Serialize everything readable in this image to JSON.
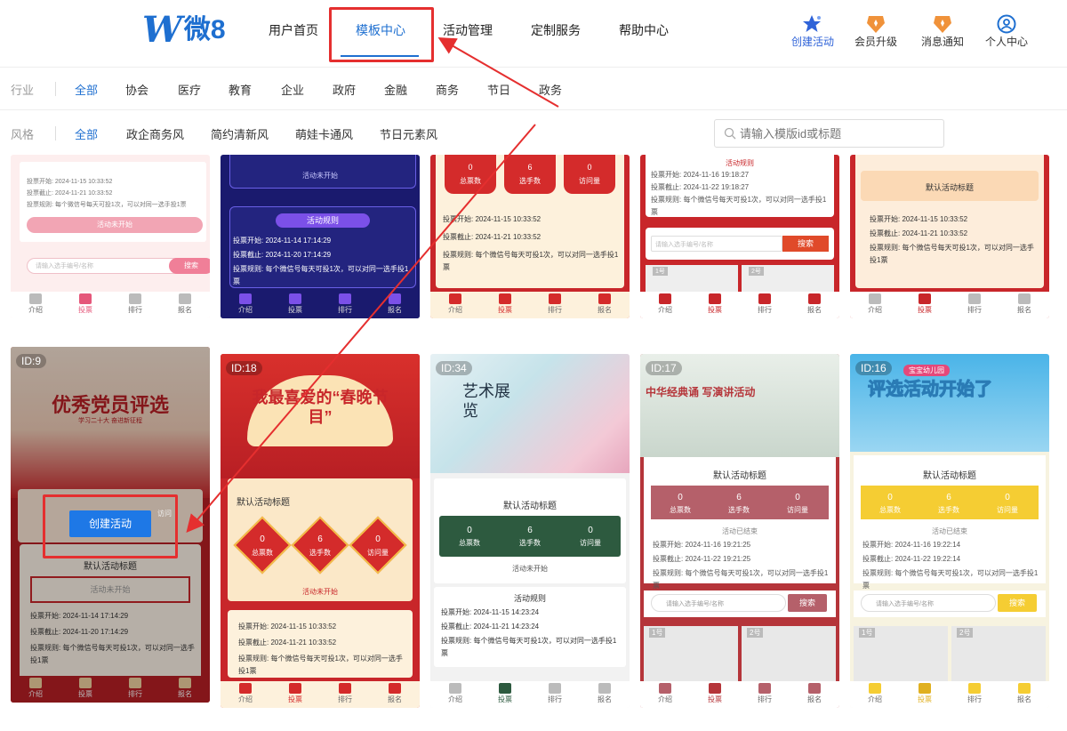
{
  "header": {
    "logo_w": "W",
    "logo_text": "微8",
    "nav": [
      "用户首页",
      "模板中心",
      "活动管理",
      "定制服务",
      "帮助中心"
    ],
    "actions": [
      {
        "label": "创建活动",
        "icon": "star-icon"
      },
      {
        "label": "会员升级",
        "icon": "medal-icon"
      },
      {
        "label": "消息通知",
        "icon": "medal-icon"
      },
      {
        "label": "个人中心",
        "icon": "user-icon"
      }
    ]
  },
  "filters": {
    "industry_label": "行业",
    "industries": [
      "全部",
      "协会",
      "医疗",
      "教育",
      "企业",
      "政府",
      "金融",
      "商务",
      "节日",
      "政务"
    ],
    "style_label": "风格",
    "styles": [
      "全部",
      "政企商务风",
      "简约清新风",
      "萌娃卡通风",
      "节日元素风"
    ],
    "search_placeholder": "请输入模版id或标题"
  },
  "common": {
    "tabs": [
      "介绍",
      "投票",
      "排行",
      "报名"
    ],
    "default_title": "默认活动标题",
    "rules_title": "活动规则",
    "not_started": "活动未开始",
    "ended": "活动已结束",
    "total_votes": "总票数",
    "contestants": "选手数",
    "visits": "访问量",
    "search_ph": "请输入选手编号/名称",
    "search_btn": "搜索",
    "rule_text": "每个微信号每天可投1次，可以对同一选手投1票"
  },
  "top_cards": [
    {
      "start": "投票开始: 2024-11-15 10:33:52",
      "end": "投票截止: 2024-11-21 10:33:52",
      "rule": "投票规则: 每个微信号每天可投1次，可以对同一选手投1票",
      "btn": "活动未开始",
      "search": "请输入选手编号/名称",
      "search_btn": "搜索"
    },
    {
      "status": "活动未开始",
      "rules_title": "活动规则",
      "start": "投票开始: 2024-11-14 17:14:29",
      "end": "投票截止: 2024-11-20 17:14:29",
      "rule": "投票规则: 每个微信号每天可投1次，可以对同一选手投1票"
    },
    {
      "n": [
        "0",
        "6",
        "0"
      ],
      "start": "投票开始: 2024-11-15 10:33:52",
      "end": "投票截止: 2024-11-21 10:33:52",
      "rule": "投票规则: 每个微信号每天可投1次，可以对同一选手投1票"
    },
    {
      "rules_title": "活动规则",
      "start": "投票开始: 2024-11-16 19:18:27",
      "end": "投票截止: 2024-11-22 19:18:27",
      "rule": "投票规则: 每个微信号每天可投1次，可以对同一选手投1票",
      "search": "请输入选手编号/名称",
      "search_btn": "搜索",
      "p1": "1号",
      "p2": "2号"
    },
    {
      "title": "默认活动标题",
      "start": "投票开始: 2024-11-15 10:33:52",
      "end": "投票截止: 2024-11-21 10:33:52",
      "rule": "投票规则: 每个微信号每天可投1次，可以对同一选手投1票"
    }
  ],
  "cards": [
    {
      "id": "ID:9",
      "banner_title": "优秀党员评选",
      "banner_sub": "学习二十大 奋进新征程",
      "title": "默认活动标题",
      "status": "活动未开始",
      "start": "投票开始: 2024-11-14 17:14:29",
      "end": "投票截止: 2024-11-20 17:14:29",
      "rule": "投票规则: 每个微信号每天可投1次，可以对同一选手投1票",
      "create_btn": "创建活动",
      "visit": "访问"
    },
    {
      "id": "ID:18",
      "banner_title": "我最喜爱的“春晚节目”",
      "title": "默认活动标题",
      "n": [
        "0",
        "6",
        "0"
      ],
      "status": "活动未开始",
      "start": "投票开始: 2024-11-15 10:33:52",
      "end": "投票截止: 2024-11-21 10:33:52",
      "rule": "投票规则: 每个微信号每天可投1次，可以对同一选手投1票"
    },
    {
      "id": "ID:34",
      "banner_title": "艺术展览",
      "title": "默认活动标题",
      "n": [
        "0",
        "6",
        "0"
      ],
      "status": "活动未开始",
      "rules_title": "活动规则",
      "start": "投票开始: 2024-11-15 14:23:24",
      "end": "投票截止: 2024-11-21 14:23:24",
      "rule": "投票规则: 每个微信号每天可投1次，可以对同一选手投1票"
    },
    {
      "id": "ID:17",
      "banner_title": "中华经典诵 写演讲活动",
      "title": "默认活动标题",
      "n": [
        "0",
        "6",
        "0"
      ],
      "status": "活动已结束",
      "start": "投票开始: 2024-11-16 19:21:25",
      "end": "投票截止: 2024-11-22 19:21:25",
      "rule": "投票规则: 每个微信号每天可投1次，可以对同一选手投1票",
      "search": "请输入选手编号/名称",
      "search_btn": "搜索",
      "p1": "1号",
      "p2": "2号"
    },
    {
      "id": "ID:16",
      "banner_title": "评选活动开始了",
      "banner_tag": "宝宝幼儿园",
      "title": "默认活动标题",
      "n": [
        "0",
        "6",
        "0"
      ],
      "status": "活动已结束",
      "start": "投票开始: 2024-11-16 19:22:14",
      "end": "投票截止: 2024-11-22 19:22:14",
      "rule": "投票规则: 每个微信号每天可投1次，可以对同一选手投1票",
      "search": "请输入选手编号/名称",
      "search_btn": "搜索",
      "p1": "1号",
      "p2": "2号"
    }
  ],
  "colors": {
    "primary": "#1e6fd0",
    "annotation": "#e52f2f"
  }
}
